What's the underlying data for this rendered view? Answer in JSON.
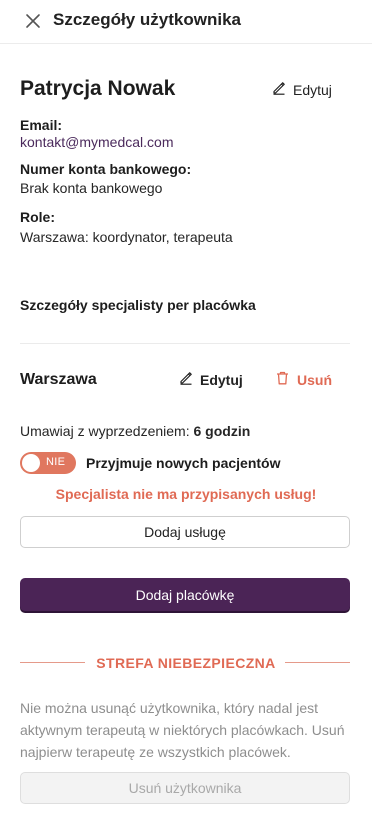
{
  "header": {
    "title": "Szczegóły użytkownika",
    "close_icon": "close-icon"
  },
  "user": {
    "name": "Patrycja Nowak",
    "edit_label": "Edytuj",
    "email_label": "Email:",
    "email": "kontakt@mymedcal.com",
    "bank_label": "Numer konta bankowego:",
    "bank_value": "Brak konta bankowego",
    "roles_label": "Role:",
    "roles_value": "Warszawa: koordynator, terapeuta"
  },
  "specialist": {
    "section_title": "Szczegóły specjalisty per placówka",
    "facility": {
      "name": "Warszawa",
      "edit_label": "Edytuj",
      "delete_label": "Usuń",
      "advance_prefix": "Umawiaj z wyprzedzeniem:",
      "advance_value": "6 godzin",
      "toggle_text": "NIE",
      "toggle_label": "Przyjmuje nowych pacjentów",
      "warning": "Specjalista nie ma przypisanych usług!",
      "add_service_label": "Dodaj usługę"
    },
    "add_facility_label": "Dodaj placówkę"
  },
  "danger_zone": {
    "title": "STREFA NIEBEZPIECZNA",
    "note": "Nie można usunąć użytkownika, który nadal jest aktywnym terapeutą w niektórych placówkach. Usuń najpierw terapeutę ze wszystkich placówek.",
    "delete_user_label": "Usuń użytkownika"
  },
  "colors": {
    "accent": "#4b2456",
    "danger": "#e06a54",
    "toggle_off": "#e0775f"
  }
}
